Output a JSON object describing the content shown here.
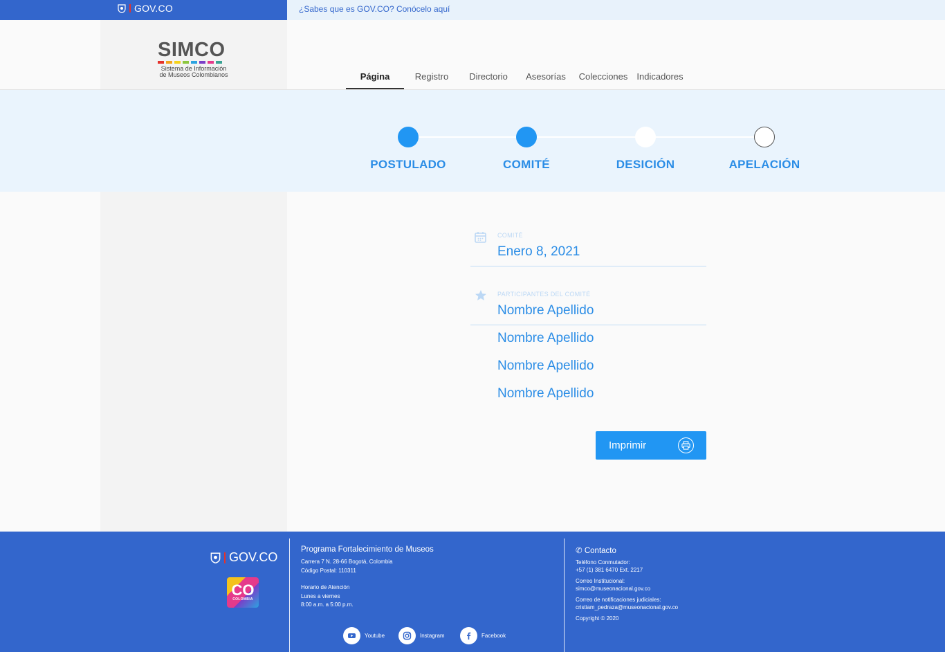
{
  "gov_bar": {
    "logo_text": "GOV.CO",
    "question": "¿Sabes que es GOV.CO? Conócelo aquí"
  },
  "header": {
    "logo_word": "SIMCO",
    "logo_sub_line1": "Sistema de Información",
    "logo_sub_line2": "de Museos Colombianos",
    "logo_bar_colors": [
      "#e4322b",
      "#f4a51c",
      "#f4d21c",
      "#8cc63f",
      "#2ca3e0",
      "#7a3ec8",
      "#e53a8b",
      "#3aa394"
    ],
    "nav": [
      {
        "label": "Página",
        "active": true
      },
      {
        "label": "Registro",
        "active": false
      },
      {
        "label": "Directorio",
        "active": false
      },
      {
        "label": "Asesorías",
        "active": false
      },
      {
        "label": "Colecciones",
        "active": false
      },
      {
        "label": "Indicadores",
        "active": false
      }
    ]
  },
  "stepper": {
    "steps": [
      {
        "label": "POSTULADO",
        "state": "complete"
      },
      {
        "label": "COMITÉ",
        "state": "complete"
      },
      {
        "label": "DESICIÓN",
        "state": "pending"
      },
      {
        "label": "APELACIÓN",
        "state": "inactive"
      }
    ],
    "accent": "#2196f3"
  },
  "form": {
    "date_label": "COMITÉ",
    "date_value": "Enero 8, 2021",
    "participants_label": "PARTICIPANTES DEL COMITÉ",
    "participants": [
      "Nombre Apellido",
      "Nombre Apellido",
      "Nombre Apellido",
      "Nombre Apellido"
    ],
    "print_label": "Imprimir"
  },
  "footer": {
    "gov_logo_text": "GOV.CO",
    "co_logo_text": "CO",
    "co_logo_sub": "COLOMBIA",
    "program_title": "Programa Fortalecimiento de Museos",
    "address_line1": "Carrera 7 N. 28-66 Bogotá, Colombia",
    "address_line2": "Código Postal: 110311",
    "hours_title": "Horario de Atención",
    "hours_days": "Lunes a viernes",
    "hours_time": "8:00 a.m. a 5:00 p.m.",
    "social": [
      {
        "label": "Youtube",
        "icon": "youtube-icon"
      },
      {
        "label": "Instagram",
        "icon": "instagram-icon"
      },
      {
        "label": "Facebook",
        "icon": "facebook-icon"
      }
    ],
    "contact_title": "Contacto",
    "phone_label": "Teléfono Conmutador:",
    "phone_value": "+57 (1) 381 6470 Ext. 2217",
    "email_label": "Correo Institucional:",
    "email_value": "simco@museonacional.gov.co",
    "judicial_label": "Correo de notificaciones judiciales:",
    "judicial_value": "cristiam_pedraza@museonacional.gov.co",
    "copyright": "Copyright © 2020"
  }
}
